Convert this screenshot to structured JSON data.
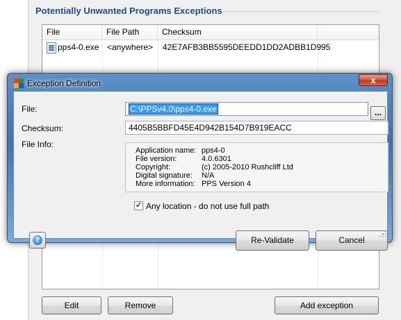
{
  "background": {
    "group_title": "Potentially Unwanted Programs Exceptions",
    "columns": [
      "File",
      "File Path",
      "Checksum"
    ],
    "rows": [
      {
        "file": "pps4-0.exe",
        "path": "<anywhere>",
        "checksum": "42E7AFB3BB5595DEEDD1DD2ADBB1D995"
      }
    ],
    "buttons": {
      "edit": "Edit",
      "remove": "Remove",
      "add": "Add exception"
    }
  },
  "dialog": {
    "title": "Exception Definition",
    "close_glyph": "x",
    "file_label": "File:",
    "file_value": "C:\\PPSv4.0\\pps4-0.exe",
    "browse_label": "...",
    "checksum_label": "Checksum:",
    "checksum_value": "4405B5BBFD45E4D942B154D7B919EACC",
    "fileinfo_label": "File Info:",
    "file_info": [
      {
        "key": "Application name:",
        "value": "pps4-0"
      },
      {
        "key": "File version:",
        "value": "4.0.6301"
      },
      {
        "key": "Copyright:",
        "value": "(c) 2005-2010 Rushcliff Ltd"
      },
      {
        "key": "Digital signature:",
        "value": "N/A"
      },
      {
        "key": "More information:",
        "value": "PPS Version 4"
      }
    ],
    "any_location_label": "Any location - do not use full path",
    "any_location_checked": true,
    "help_glyph": "?",
    "revalidate_label": "Re-Validate",
    "cancel_label": "Cancel"
  },
  "colors": {
    "group_title": "#1d4a8c",
    "selection": "#3399ff",
    "close_button": "#c03a1f"
  }
}
